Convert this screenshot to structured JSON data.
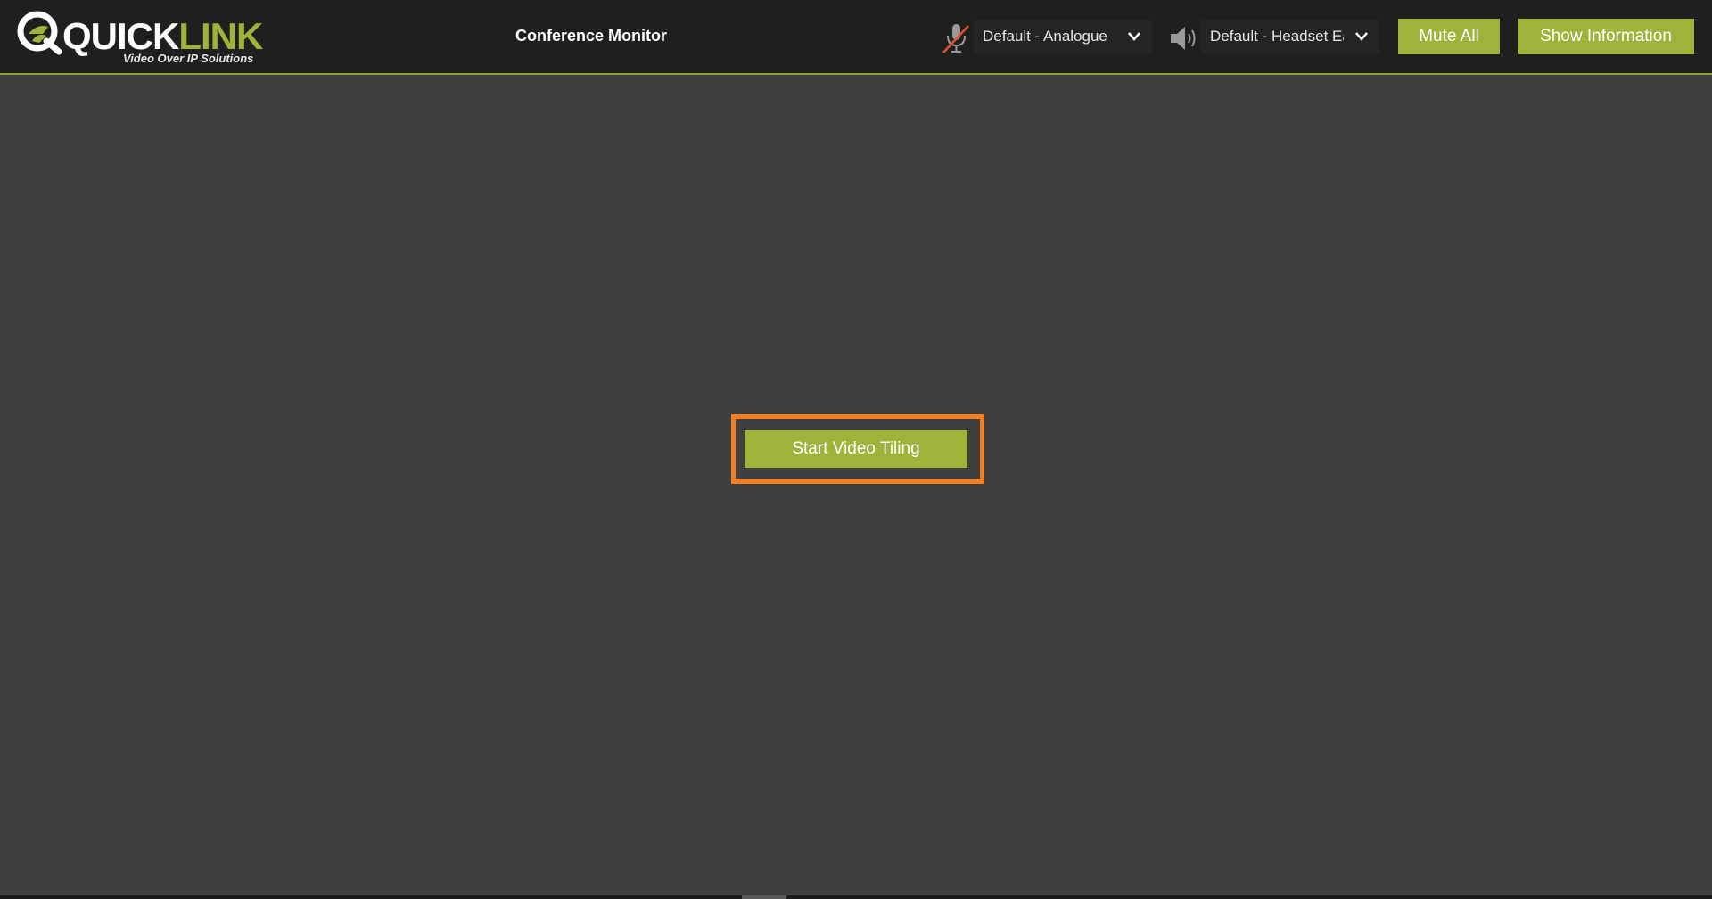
{
  "logo": {
    "word_quick": "QUICK",
    "word_link": "LINK",
    "tagline": "Video Over IP Solutions",
    "icon": "quicklink-logo-mark"
  },
  "header": {
    "title": "Conference Monitor",
    "mic_icon": "microphone-muted-icon",
    "mic_select": {
      "value": "Default - Analogue"
    },
    "speaker_icon": "speaker-icon",
    "speaker_select": {
      "value": "Default - Headset Ea"
    },
    "mute_all_label": "Mute All",
    "show_info_label": "Show Information"
  },
  "main": {
    "start_tiling_label": "Start Video Tiling"
  },
  "colors": {
    "accent": "#9db339",
    "header_bg": "#1f1f1f",
    "canvas_bg": "#403f40",
    "highlight": "#f57f20"
  }
}
